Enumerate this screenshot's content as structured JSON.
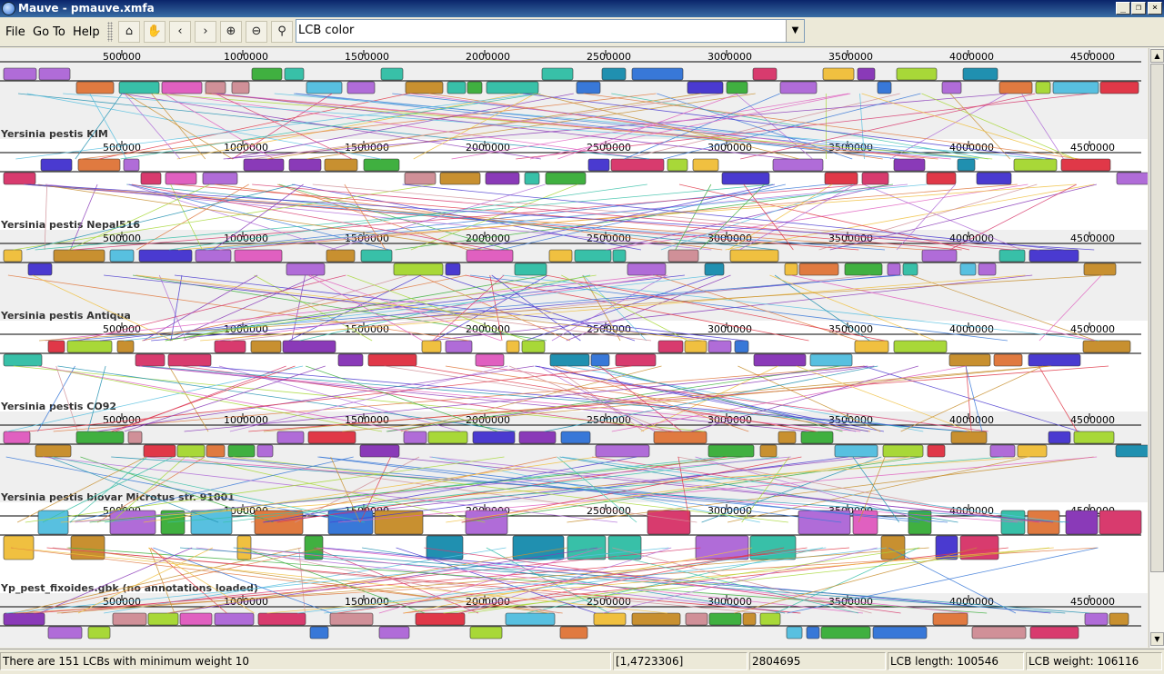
{
  "window": {
    "title": "Mauve - pmauve.xmfa"
  },
  "menu": {
    "file": "File",
    "goto": "Go To",
    "help": "Help"
  },
  "toolbar": {
    "buttons": [
      {
        "name": "home-icon",
        "glyph": "⌂"
      },
      {
        "name": "hand-icon",
        "glyph": "✋"
      },
      {
        "name": "shift-left-icon",
        "glyph": "‹"
      },
      {
        "name": "shift-right-icon",
        "glyph": "›"
      },
      {
        "name": "zoom-in-icon",
        "glyph": "⊕"
      },
      {
        "name": "zoom-out-icon",
        "glyph": "⊖"
      },
      {
        "name": "zoom-search-icon",
        "glyph": "⚲"
      }
    ],
    "color_scheme": "LCB color"
  },
  "genomes": [
    {
      "label": "",
      "ticks": [
        "500000",
        "1000000",
        "1500000",
        "2000000",
        "2500000",
        "3000000",
        "3500000",
        "4000000",
        "4500000"
      ]
    },
    {
      "label": "Yersinia pestis KIM",
      "ticks": [
        "500000",
        "1000000",
        "1500000",
        "2000000",
        "2500000",
        "3000000",
        "3500000",
        "4000000",
        "4500000"
      ]
    },
    {
      "label": "Yersinia pestis Nepal516",
      "ticks": [
        "500000",
        "1000000",
        "1500000",
        "2000000",
        "2500000",
        "3000000",
        "3500000",
        "4000000",
        "4500000"
      ]
    },
    {
      "label": "Yersinia pestis Antiqua",
      "ticks": [
        "500000",
        "1000000",
        "1500000",
        "2000000",
        "2500000",
        "3000000",
        "3500000",
        "4000000",
        "4500000"
      ]
    },
    {
      "label": "Yersinia pestis CO92",
      "ticks": [
        "500000",
        "1000000",
        "1500000",
        "2000000",
        "2500000",
        "3000000",
        "3500000",
        "4000000",
        "4500000"
      ]
    },
    {
      "label": "Yersinia pestis biovar Microtus str. 91001",
      "ticks": [
        "500000",
        "1000000",
        "1500000",
        "2000000",
        "2500000",
        "3000000",
        "3500000",
        "4000000",
        "4500000"
      ]
    },
    {
      "label": "Yp_pest_fixoides.gbk (no annotations loaded)",
      "ticks": [
        "500000",
        "1000000",
        "1500000",
        "2000000",
        "2500000",
        "3000000",
        "3500000",
        "4000000",
        "4500000"
      ]
    }
  ],
  "colors": [
    "#d83b6e",
    "#b06cd8",
    "#58c0e0",
    "#a8d838",
    "#e07a40",
    "#4a3ad0",
    "#e03848",
    "#38c0a8",
    "#e060c0",
    "#f0c040",
    "#40b040",
    "#3878d8",
    "#c89030",
    "#2090b0",
    "#8a3ab8",
    "#d09098"
  ],
  "status": {
    "message": "There are 151 LCBs with minimum weight 10",
    "range": "[1,4723306]",
    "position": "2804695",
    "lcb_length": "LCB length: 100546",
    "lcb_weight": "LCB weight: 106116"
  }
}
